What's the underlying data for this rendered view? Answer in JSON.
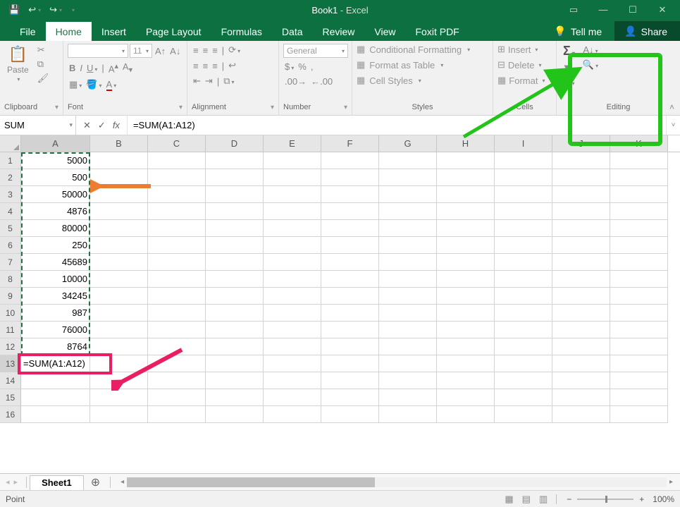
{
  "titlebar": {
    "doc": "Book1",
    "app": "Excel"
  },
  "tabs": [
    "File",
    "Home",
    "Insert",
    "Page Layout",
    "Formulas",
    "Data",
    "Review",
    "View",
    "Foxit PDF"
  ],
  "active_tab": "Home",
  "tellme": "Tell me",
  "share": "Share",
  "ribbon": {
    "clipboard": {
      "label": "Clipboard",
      "paste": "Paste"
    },
    "font": {
      "label": "Font",
      "size": "11"
    },
    "alignment": {
      "label": "Alignment"
    },
    "number": {
      "label": "Number",
      "format": "General"
    },
    "styles": {
      "label": "Styles",
      "conditional": "Conditional Formatting",
      "table": "Format as Table",
      "cellstyles": "Cell Styles"
    },
    "cells": {
      "label": "Cells",
      "insert": "Insert",
      "delete": "Delete",
      "format": "Format"
    },
    "editing": {
      "label": "Editing"
    }
  },
  "namebox": "SUM",
  "formula": "=SUM(A1:A12)",
  "columns": [
    "A",
    "B",
    "C",
    "D",
    "E",
    "F",
    "G",
    "H",
    "I",
    "J",
    "K"
  ],
  "rows": [
    1,
    2,
    3,
    4,
    5,
    6,
    7,
    8,
    9,
    10,
    11,
    12,
    13,
    14,
    15,
    16
  ],
  "dataA": [
    "5000",
    "500",
    "50000",
    "4876",
    "80000",
    "250",
    "45689",
    "10000",
    "34245",
    "987",
    "76000",
    "8764",
    "=SUM(A1:A12)"
  ],
  "active_row": 13,
  "active_col": "A",
  "sheet_tabs": [
    "Sheet1"
  ],
  "statusbar": {
    "mode": "Point",
    "zoom": "100%"
  },
  "chart_data": null
}
